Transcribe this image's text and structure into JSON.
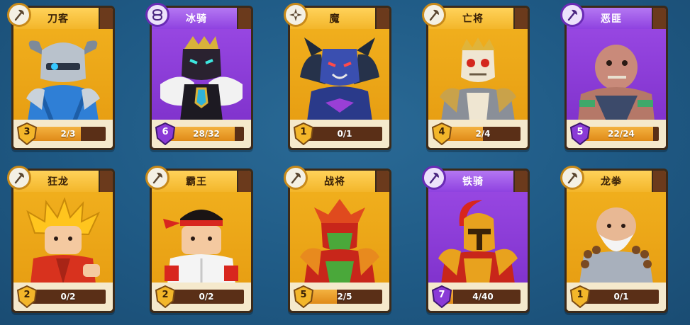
{
  "colors": {
    "background": "#1f5a85",
    "card_gold": "#f2b21f",
    "card_purple": "#8f42e0",
    "progress_track": "#5a2f17",
    "progress_fill": "#e08a18"
  },
  "cards": [
    {
      "name": "刀客",
      "rarity": "gold",
      "class_icon": "axe-icon",
      "level": "3",
      "shards": "2/3",
      "progress": 0.67,
      "portrait": "blue-armored-knight"
    },
    {
      "name": "冰骑",
      "rarity": "purple",
      "class_icon": "infinity-icon",
      "level": "6",
      "shards": "28/32",
      "progress": 0.875,
      "portrait": "ice-knight-with-fur"
    },
    {
      "name": "魔",
      "rarity": "gold",
      "class_icon": "compass-icon",
      "level": "1",
      "shards": "0/1",
      "progress": 0,
      "portrait": "dark-demon-lord"
    },
    {
      "name": "亡将",
      "rarity": "gold",
      "class_icon": "axe-icon",
      "level": "4",
      "shards": "2/4",
      "progress": 0.5,
      "portrait": "skeleton-king"
    },
    {
      "name": "恶匪",
      "rarity": "purple",
      "class_icon": "axe-icon",
      "level": "5",
      "shards": "22/24",
      "progress": 0.92,
      "portrait": "bald-brute"
    },
    {
      "name": "狂龙",
      "rarity": "gold",
      "class_icon": "axe-icon",
      "level": "2",
      "shards": "0/2",
      "progress": 0,
      "portrait": "spiky-hair-fighter"
    },
    {
      "name": "霸王",
      "rarity": "gold",
      "class_icon": "axe-icon",
      "level": "2",
      "shards": "0/2",
      "progress": 0,
      "portrait": "headband-martial-artist"
    },
    {
      "name": "战将",
      "rarity": "gold",
      "class_icon": "axe-icon",
      "level": "5",
      "shards": "2/5",
      "progress": 0.4,
      "portrait": "red-samurai"
    },
    {
      "name": "铁骑",
      "rarity": "purple",
      "class_icon": "axe-icon",
      "level": "7",
      "shards": "4/40",
      "progress": 0.1,
      "portrait": "spartan-warrior"
    },
    {
      "name": "龙拳",
      "rarity": "gold",
      "class_icon": "axe-icon",
      "level": "1",
      "shards": "0/1",
      "progress": 0,
      "portrait": "bearded-monk"
    }
  ]
}
